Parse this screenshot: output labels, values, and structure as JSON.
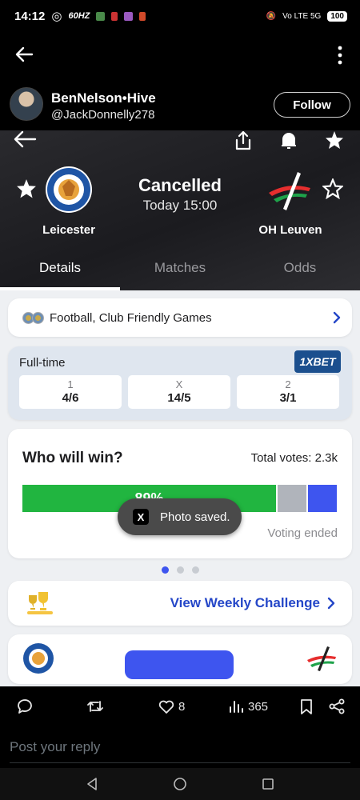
{
  "status_bar": {
    "time": "14:12",
    "refresh_rate": "60HZ",
    "network": "Vo LTE 5G",
    "battery": "100"
  },
  "post": {
    "author_name": "BenNelson•Hive",
    "author_handle": "@JackDonnelly278",
    "follow_label": "Follow"
  },
  "match": {
    "home_team": "Leicester",
    "away_team": "OH Leuven",
    "status": "Cancelled",
    "kickoff": "Today 15:00",
    "tabs": [
      "Details",
      "Matches",
      "Odds"
    ],
    "active_tab": "Details",
    "competition": "Football, Club Friendly Games",
    "odds": {
      "label": "Full-time",
      "bookmaker": "1XBET",
      "options": [
        {
          "label": "1",
          "value": "4/6"
        },
        {
          "label": "X",
          "value": "14/5"
        },
        {
          "label": "2",
          "value": "3/1"
        }
      ]
    },
    "vote": {
      "question": "Who will win?",
      "total_votes": "Total votes: 2.3k",
      "home_pct_label": "89%",
      "home_share": 0.89,
      "ended_label": "Voting ended"
    },
    "carousel": {
      "pages": 3,
      "current": 1
    },
    "weekly_challenge": "View Weekly Challenge"
  },
  "toast": {
    "label": "Photo saved."
  },
  "actions": {
    "likes": "8",
    "views": "365"
  },
  "reply_placeholder": "Post your reply",
  "colors": {
    "home_bar": "#21b540",
    "draw_bar": "#b0b4bb",
    "away_bar": "#3e55ef",
    "link": "#2547c8"
  }
}
